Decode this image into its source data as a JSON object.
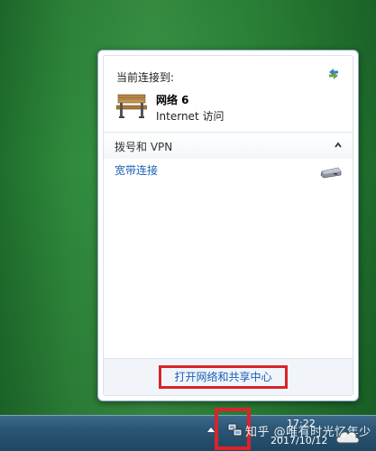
{
  "flyout": {
    "connected_header": "当前连接到:",
    "network": {
      "name": "网络  6",
      "status": "Internet 访问",
      "icon": "bench-icon"
    },
    "section": {
      "label": "拨号和 VPN",
      "collapse_icon": "chevron-up-icon"
    },
    "items": [
      {
        "label": "宽带连接",
        "icon": "modem-icon"
      }
    ],
    "footer_link": "打开网络和共享中心",
    "refresh_icon": "refresh-arrows-icon"
  },
  "taskbar": {
    "watermark": "知乎 @唯有时光忆年少",
    "clock_time": "17:22",
    "clock_date": "2017/10/12",
    "icons": [
      "tray-up-arrow-icon",
      "network-tray-icon",
      "cloud-icon"
    ]
  },
  "colors": {
    "highlight_red": "#d9242a",
    "link_blue": "#1a5fb4",
    "desktop_green": "#2f8a3c"
  }
}
